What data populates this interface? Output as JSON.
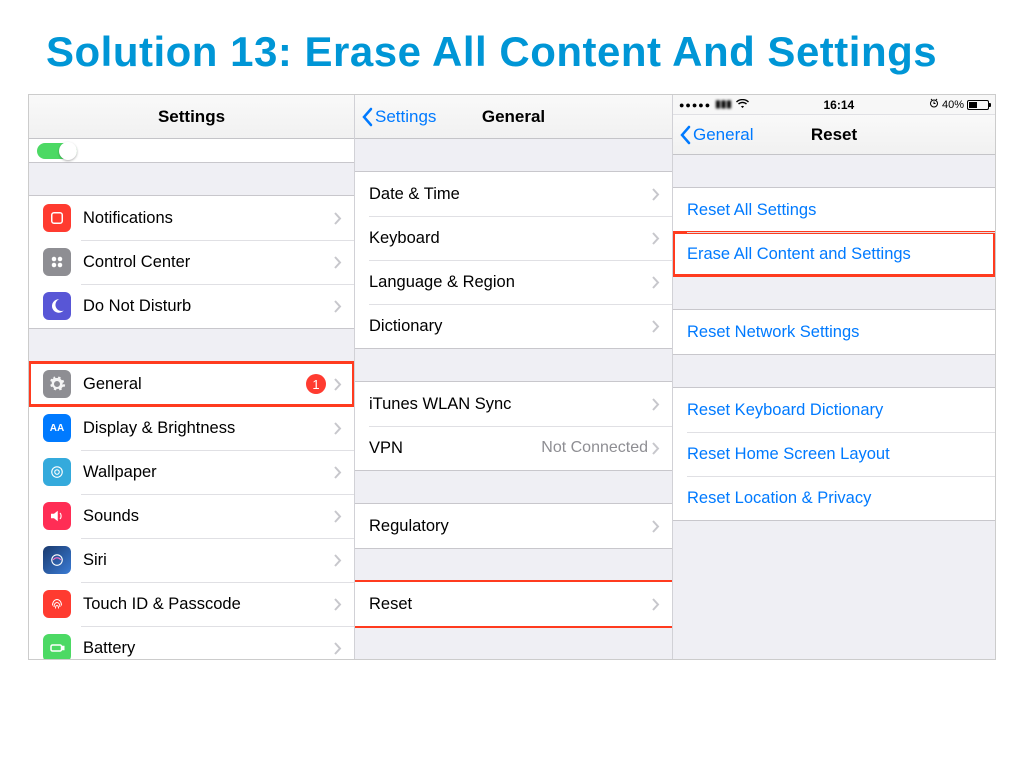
{
  "title": "Solution 13: Erase All Content And Settings",
  "panel1": {
    "nav_title": "Settings",
    "rows_a": [
      {
        "label": "Notifications",
        "icon": "notif"
      },
      {
        "label": "Control Center",
        "icon": "cc"
      },
      {
        "label": "Do Not Disturb",
        "icon": "dnd"
      }
    ],
    "rows_b": [
      {
        "label": "General",
        "icon": "gen",
        "badge": "1",
        "highlight": true
      },
      {
        "label": "Display & Brightness",
        "icon": "disp"
      },
      {
        "label": "Wallpaper",
        "icon": "wall"
      },
      {
        "label": "Sounds",
        "icon": "snd"
      },
      {
        "label": "Siri",
        "icon": "siri"
      },
      {
        "label": "Touch ID & Passcode",
        "icon": "tid"
      },
      {
        "label": "Battery",
        "icon": "batt"
      }
    ]
  },
  "panel2": {
    "back": "Settings",
    "nav_title": "General",
    "rows_a": [
      {
        "label": "Date & Time"
      },
      {
        "label": "Keyboard"
      },
      {
        "label": "Language & Region"
      },
      {
        "label": "Dictionary"
      }
    ],
    "rows_b": [
      {
        "label": "iTunes WLAN Sync"
      },
      {
        "label": "VPN",
        "detail": "Not Connected"
      }
    ],
    "rows_c": [
      {
        "label": "Regulatory"
      }
    ],
    "rows_d": [
      {
        "label": "Reset",
        "highlight": true
      }
    ]
  },
  "panel3": {
    "status": {
      "time": "16:14",
      "battery_pct": "40%",
      "carrier": "•••••"
    },
    "back": "General",
    "nav_title": "Reset",
    "rows_a": [
      {
        "label": "Reset All Settings"
      },
      {
        "label": "Erase All Content and Settings",
        "highlight": true
      }
    ],
    "rows_b": [
      {
        "label": "Reset Network Settings"
      }
    ],
    "rows_c": [
      {
        "label": "Reset Keyboard Dictionary"
      },
      {
        "label": "Reset Home Screen Layout"
      },
      {
        "label": "Reset Location & Privacy"
      }
    ]
  }
}
